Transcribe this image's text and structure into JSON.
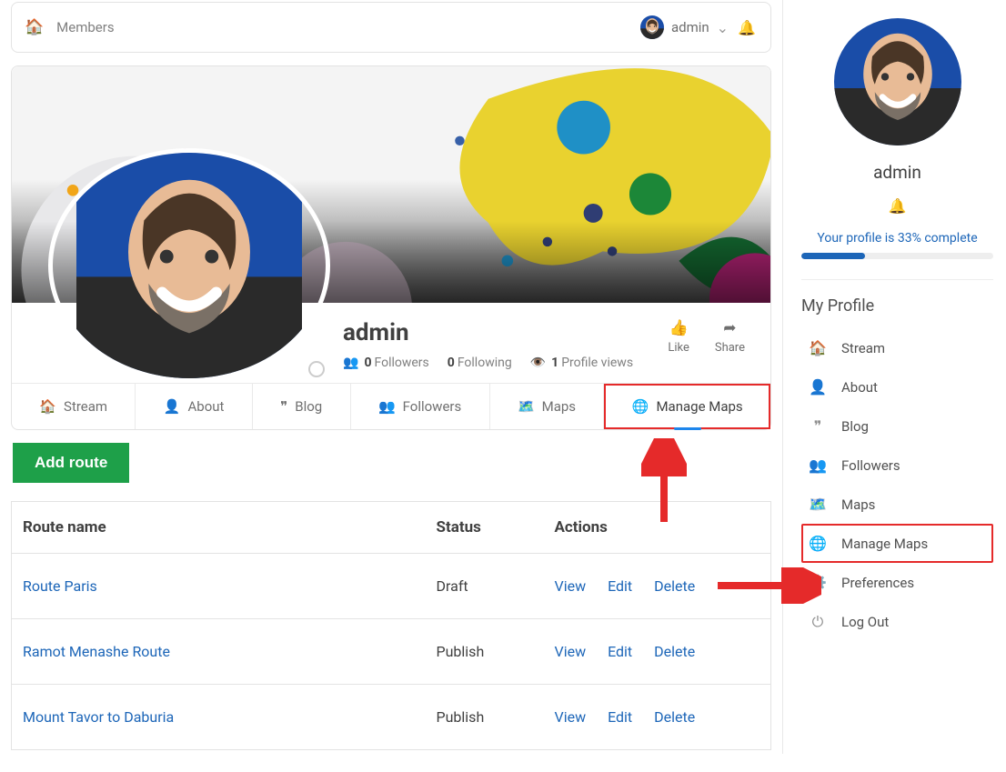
{
  "topbar": {
    "breadcrumb": "Members",
    "username": "admin"
  },
  "profile": {
    "display_name": "admin",
    "followers_count": "0",
    "followers_label": "Followers",
    "following_count": "0",
    "following_label": "Following",
    "views_count": "1",
    "views_label": "Profile views",
    "like_label": "Like",
    "share_label": "Share"
  },
  "tabs": {
    "stream": "Stream",
    "about": "About",
    "blog": "Blog",
    "followers": "Followers",
    "maps": "Maps",
    "manage_maps": "Manage Maps"
  },
  "add_route_label": "Add route",
  "table": {
    "header_route": "Route name",
    "header_status": "Status",
    "header_actions": "Actions",
    "view": "View",
    "edit": "Edit",
    "delete": "Delete",
    "rows": [
      {
        "name": "Route Paris",
        "status": "Draft"
      },
      {
        "name": "Ramot Menashe Route",
        "status": "Publish"
      },
      {
        "name": "Mount Tavor to Daburia",
        "status": "Publish"
      }
    ]
  },
  "sidebar": {
    "username": "admin",
    "progress_text": "Your profile is 33% complete",
    "progress_pct": 33,
    "heading": "My Profile",
    "items": {
      "stream": "Stream",
      "about": "About",
      "blog": "Blog",
      "followers": "Followers",
      "maps": "Maps",
      "manage_maps": "Manage Maps",
      "preferences": "Preferences",
      "logout": "Log Out"
    }
  }
}
